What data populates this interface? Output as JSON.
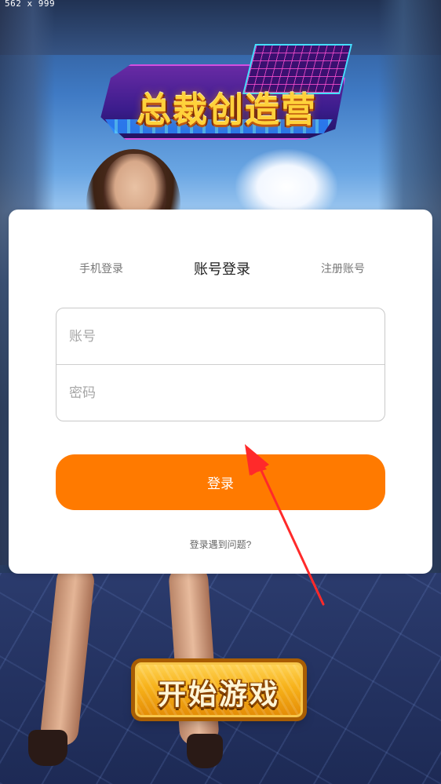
{
  "screen_size_label": "562 x 999",
  "logo": {
    "title": "总裁创造营"
  },
  "login": {
    "tabs": [
      {
        "label": "手机登录",
        "active": false
      },
      {
        "label": "账号登录",
        "active": true
      },
      {
        "label": "注册账号",
        "active": false
      }
    ],
    "account_placeholder": "账号",
    "password_placeholder": "密码",
    "login_button_label": "登录",
    "help_link_label": "登录遇到问题?"
  },
  "start_button": {
    "label": "开始游戏"
  },
  "colors": {
    "accent": "#ff7a00",
    "annotation_arrow": "#ff2a2a",
    "card_bg": "#ffffff"
  }
}
